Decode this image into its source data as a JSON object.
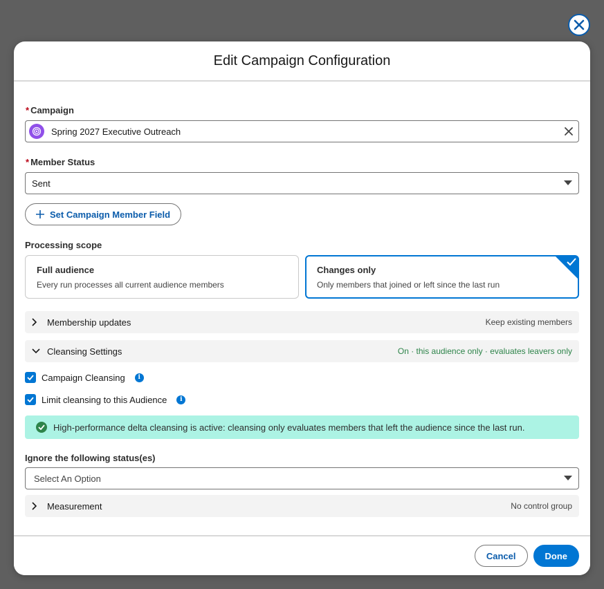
{
  "modal": {
    "title": "Edit Campaign Configuration"
  },
  "campaign": {
    "label": "Campaign",
    "required_mark": "*",
    "value": "Spring 2027 Executive Outreach"
  },
  "member_status": {
    "label": "Member Status",
    "required_mark": "*",
    "value": "Sent"
  },
  "set_field_button": {
    "label": "Set Campaign Member Field"
  },
  "processing_scope": {
    "label": "Processing scope",
    "options": [
      {
        "title": "Full audience",
        "description": "Every run processes all current audience members",
        "selected": false
      },
      {
        "title": "Changes only",
        "description": "Only members that joined or left since the last run",
        "selected": true
      }
    ]
  },
  "sections": {
    "membership": {
      "label": "Membership updates",
      "summary": "Keep existing members",
      "expanded": false
    },
    "cleansing": {
      "label": "Cleansing Settings",
      "summary": "On · this audience only · evaluates leavers only",
      "expanded": true
    },
    "measurement": {
      "label": "Measurement",
      "summary": "No control group",
      "expanded": false
    }
  },
  "cleansing_options": {
    "campaign_cleansing": {
      "label": "Campaign Cleansing",
      "checked": true
    },
    "limit_cleansing": {
      "label": "Limit cleansing to this Audience",
      "checked": true
    }
  },
  "alert": {
    "text": "High-performance delta cleansing is active: cleansing only evaluates members that left the audience since the last run."
  },
  "ignore_status": {
    "label": "Ignore the following status(es)",
    "placeholder": "Select An Option"
  },
  "footer": {
    "cancel_label": "Cancel",
    "done_label": "Done"
  },
  "colors": {
    "brand": "#0176d3",
    "brand_dark": "#0b5cab",
    "success": "#2e844a",
    "alert_bg": "#acf3e4",
    "required": "#ba0517",
    "campaign_icon": "#9050e9"
  },
  "icons": {
    "close": "close-icon",
    "campaign": "campaign-icon",
    "clear": "clear-icon",
    "dropdown": "chevron-down-icon",
    "add": "add-icon",
    "expand": "chevron-right-icon",
    "collapse": "chevron-down-icon",
    "info": "info-icon",
    "success": "success-icon",
    "check": "check-icon"
  }
}
